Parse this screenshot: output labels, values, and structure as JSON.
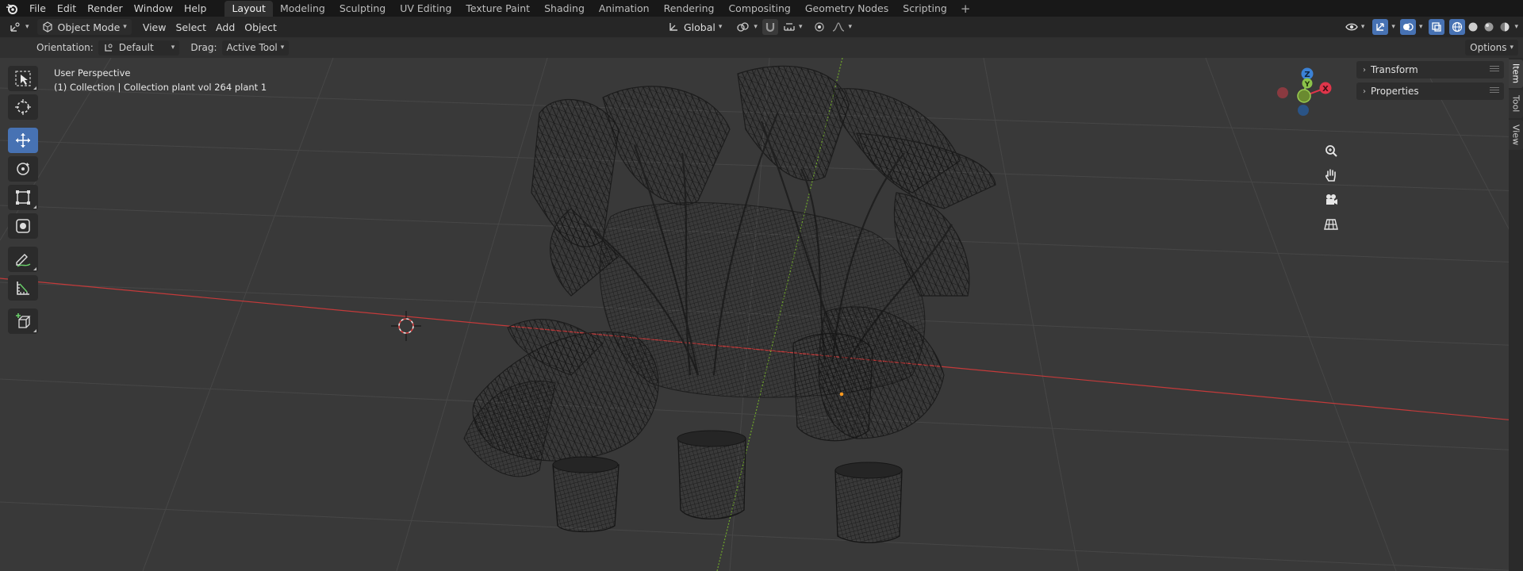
{
  "topbar": {
    "menus": [
      "File",
      "Edit",
      "Render",
      "Window",
      "Help"
    ],
    "workspaces": [
      "Layout",
      "Modeling",
      "Sculpting",
      "UV Editing",
      "Texture Paint",
      "Shading",
      "Animation",
      "Rendering",
      "Compositing",
      "Geometry Nodes",
      "Scripting"
    ],
    "active_workspace": "Layout",
    "add_symbol": "+"
  },
  "header": {
    "mode": "Object Mode",
    "menus": [
      "View",
      "Select",
      "Add",
      "Object"
    ],
    "transform_orientation": "Global"
  },
  "tool_settings": {
    "orientation_label": "Orientation:",
    "orientation_value": "Default",
    "drag_label": "Drag:",
    "drag_value": "Active Tool",
    "options_label": "Options"
  },
  "viewport": {
    "perspective": "User Perspective",
    "collection": "(1) Collection | Collection plant vol 264 plant 1",
    "background_color": "#393939",
    "x_axis_color": "#c43a3a",
    "y_axis_color": "#6fa82a"
  },
  "toolbar": {
    "tools": [
      "select-box",
      "cursor",
      "move",
      "rotate",
      "scale",
      "transform",
      "annotate",
      "measure",
      "add-cube"
    ],
    "active_tool": "move"
  },
  "gizmo": {
    "labels": {
      "x": "X",
      "y": "Y",
      "z": "Z"
    },
    "colors": {
      "x": "#e0354a",
      "y": "#8bc34a",
      "z": "#3b82d6"
    }
  },
  "side_panel": {
    "panels": [
      "Transform",
      "Properties"
    ],
    "tabs": [
      "Item",
      "Tool",
      "View"
    ],
    "active_tab": "Item"
  }
}
